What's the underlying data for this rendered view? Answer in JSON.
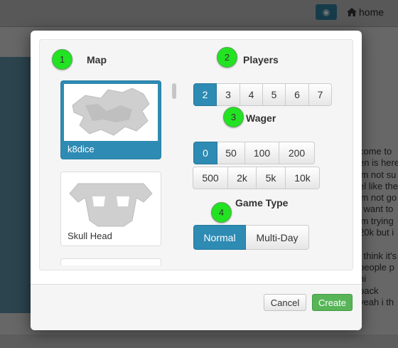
{
  "background": {
    "home_label": "home",
    "chat_lines": [
      "come to",
      "en is here",
      "'m not su",
      "el like the",
      "'m not go",
      "i want to",
      "'m trying",
      "20k but i",
      "",
      "i think it's",
      "people p",
      "hi",
      "back",
      "yeah i th"
    ]
  },
  "modal": {
    "map": {
      "title": "Map",
      "badge": "1",
      "items": [
        {
          "label": "k8dice",
          "selected": true
        },
        {
          "label": "Skull Head",
          "selected": false
        },
        {
          "label": "",
          "selected": false
        }
      ]
    },
    "players": {
      "title": "Players",
      "badge": "2",
      "options": [
        "2",
        "3",
        "4",
        "5",
        "6",
        "7"
      ],
      "selected": "2"
    },
    "wager": {
      "title": "Wager",
      "badge": "3",
      "row1": [
        "0",
        "50",
        "100",
        "200"
      ],
      "row2": [
        "500",
        "2k",
        "5k",
        "10k"
      ],
      "selected": "0"
    },
    "game_type": {
      "title": "Game Type",
      "badge": "4",
      "options": [
        "Normal",
        "Multi-Day"
      ],
      "selected": "Normal"
    },
    "footer": {
      "cancel_label": "Cancel",
      "create_label": "Create"
    }
  },
  "colors": {
    "accent": "#2e8bb3",
    "create": "#57b558",
    "badge": "#22e322"
  }
}
